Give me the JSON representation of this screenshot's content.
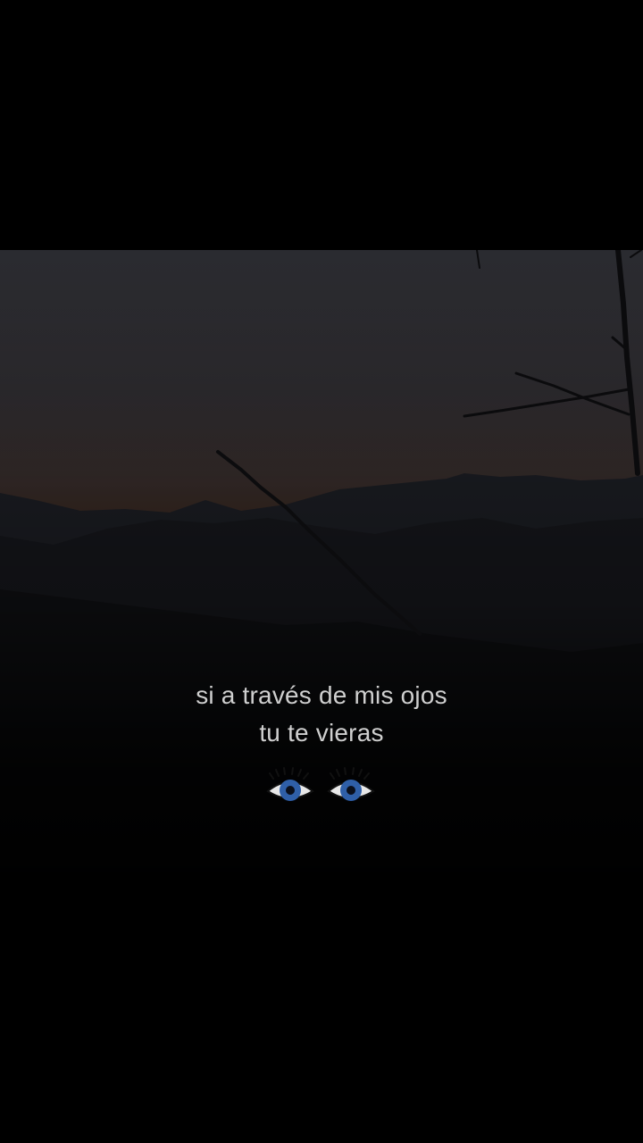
{
  "caption": {
    "line1": "si a través de mis ojos",
    "line2": "tu te vieras"
  },
  "emoji": {
    "icon": "eyes-icon",
    "iris_color": "#2f5fa8"
  },
  "colors": {
    "background": "#000000",
    "sky_top": "#2b2c31",
    "sky_bottom": "#3a2b22",
    "text": "#cfcfcf"
  }
}
